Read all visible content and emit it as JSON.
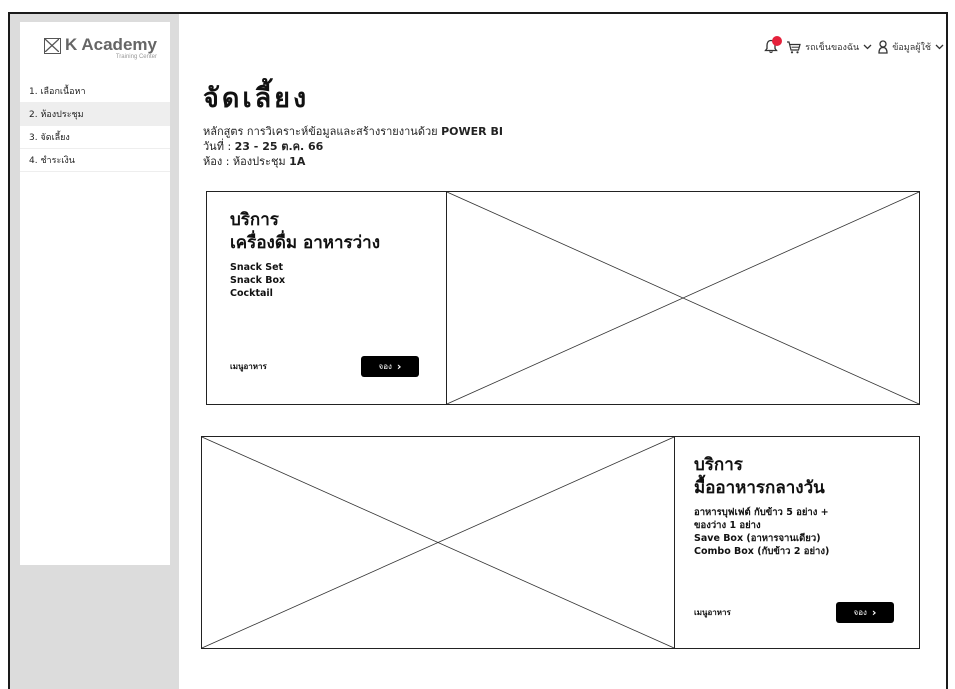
{
  "logo": {
    "title": "K Academy",
    "subtitle": "Training Center"
  },
  "sidebar": {
    "items": [
      {
        "label": "1. เลือกเนื้อหา"
      },
      {
        "label": "2. ห้องประชุม"
      },
      {
        "label": "3. จัดเลี้ยง"
      },
      {
        "label": "4. ชำระเงิน"
      }
    ]
  },
  "header": {
    "cart_label": "รถเข็นของฉัน",
    "account_label": "ข้อมูลผู้ใช้",
    "notification_color": "#e5213b"
  },
  "page": {
    "title": "จัดเลี้ยง",
    "course_prefix": "หลักสูตร การวิเคราะห์ข้อมูลและสร้างรายงานด้วย",
    "course_name": "POWER BI",
    "date_prefix": "วันที่ :",
    "date_value": "23 - 25 ต.ค. 66",
    "room_prefix": "ห้อง : ห้องประชุม",
    "room_value": "1A"
  },
  "cards": [
    {
      "title": "บริการ",
      "subtitle": "เครื่องดื่ม อาหารว่าง",
      "items": [
        "Snack Set",
        "Snack Box",
        "Cocktail"
      ],
      "menu_label": "เมนูอาหาร",
      "button_label": "จอง"
    },
    {
      "title": "บริการ",
      "subtitle": "มื้ออาหารกลางวัน",
      "items": [
        "อาหารบุฟเฟต์ กับข้าว 5 อย่าง +",
        "ของว่าง 1 อย่าง",
        "Save Box (อาหารจานเดียว)",
        "Combo Box (กับข้าว 2 อย่าง)"
      ],
      "menu_label": "เมนูอาหาร",
      "button_label": "จอง"
    }
  ]
}
